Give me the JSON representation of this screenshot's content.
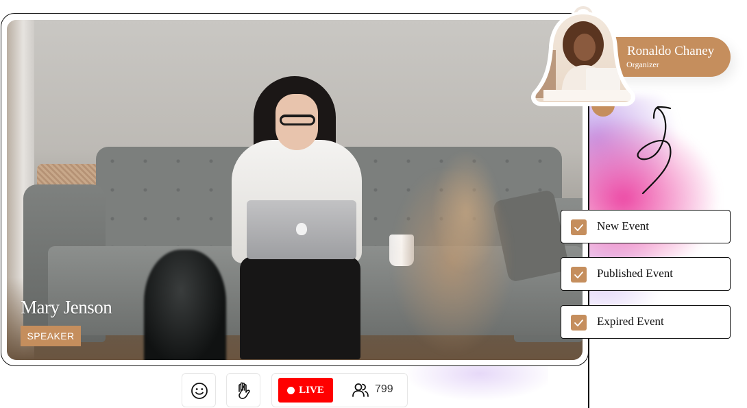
{
  "speaker": {
    "name": "Mary Jenson",
    "role_badge": "SPEAKER"
  },
  "organizer": {
    "name": "Ronaldo Chaney",
    "role": "Organizer"
  },
  "events": [
    {
      "label": "New Event",
      "checked": true
    },
    {
      "label": "Published Event",
      "checked": true
    },
    {
      "label": "Expired Event",
      "checked": true
    }
  ],
  "controls": {
    "emoji_icon": "smiley-icon",
    "raise_hand_icon": "raise-hand-icon",
    "live_label": "LIVE",
    "viewers_icon": "users-icon",
    "viewer_count": "799"
  },
  "colors": {
    "accent": "#c58e5d",
    "live": "#ff0000",
    "glow_pink": "#ec40a0",
    "glow_purple": "#b48ce6"
  }
}
